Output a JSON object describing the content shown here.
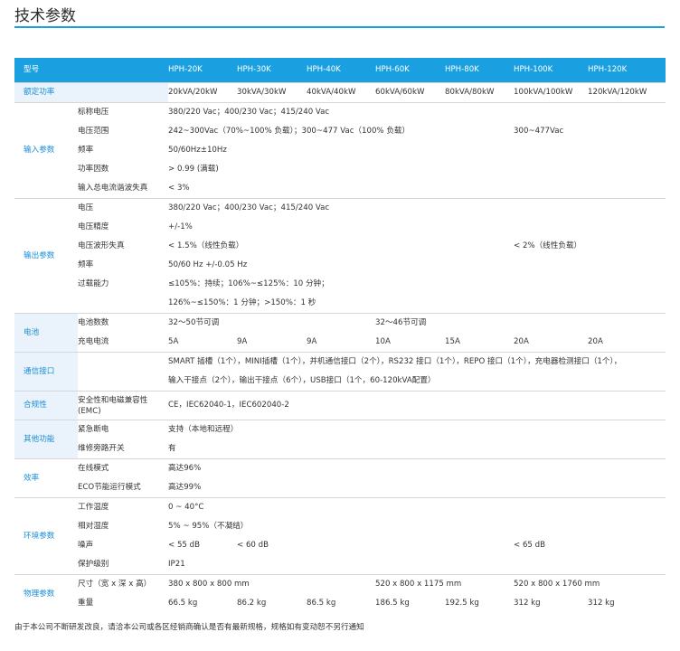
{
  "title": "技术参数",
  "models": [
    "HPH-20K",
    "HPH-30K",
    "HPH-40K",
    "HPH-60K",
    "HPH-80K",
    "HPH-100K",
    "HPH-120K"
  ],
  "model_label": "型号",
  "rated": {
    "label": "额定功率",
    "values": [
      "20kVA/20kW",
      "30kVA/30kW",
      "40kVA/40kW",
      "60kVA/60kW",
      "80kVA/80kW",
      "100kVA/100kW",
      "120kVA/120kW"
    ]
  },
  "input": {
    "group": "输入参数",
    "voltage": {
      "label": "标称电压",
      "value": "380/220 Vac；400/230 Vac；415/240 Vac"
    },
    "range": {
      "label": "电压范围",
      "value_a": "242~300Vac（70%~100% 负载）；300~477 Vac（100% 负载）",
      "value_b": "300~477Vac"
    },
    "freq": {
      "label": "频率",
      "value": "50/60Hz±10Hz"
    },
    "pf": {
      "label": "功率因数",
      "value": "> 0.99 (满载)"
    },
    "thd": {
      "label": "输入总电流谐波失真",
      "value": "< 3%"
    }
  },
  "output": {
    "group": "输出参数",
    "voltage": {
      "label": "电压",
      "value": "380/220 Vac；400/230 Vac；415/240 Vac"
    },
    "precision": {
      "label": "电压精度",
      "value": "+/-1%"
    },
    "thd": {
      "label": "电压波形失真",
      "value_a": "< 1.5%（线性负载）",
      "value_b": "< 2%（线性负载）"
    },
    "freq": {
      "label": "频率",
      "value": "50/60 Hz +/-0.05 Hz"
    },
    "overload": {
      "label": "过载能力",
      "line1": "≤105%：持续；106%~≤125%：10 分钟；",
      "line2": "126%~≤150%：1 分钟；>150%：1 秒"
    }
  },
  "battery": {
    "group": "电池",
    "count": {
      "label": "电池数数",
      "value_a": "32～50节可调",
      "value_b": "32～46节可调"
    },
    "current": {
      "label": "充电电流",
      "values": [
        "5A",
        "9A",
        "9A",
        "10A",
        "15A",
        "20A",
        "20A"
      ]
    }
  },
  "comm": {
    "group": "通信接口",
    "line1": "SMART 插槽（1个），MINI插槽（1个），并机通信接口（2个），RS232 接口（1个），REPO 接口（1个），充电器检测接口（1个），",
    "line2": "输入干接点（2个），输出干接点（6个），USB接口（1个，60-120kVA配置）"
  },
  "compliance": {
    "group": "合规性",
    "label": "安全性和电磁兼容性 (EMC)",
    "value": "CE，IEC62040-1，IEC602040-2"
  },
  "other": {
    "group": "其他功能",
    "epo": {
      "label": "紧急断电",
      "value": "支持（本地和远程）"
    },
    "bypass": {
      "label": "维修旁路开关",
      "value": "有"
    }
  },
  "efficiency": {
    "group": "效率",
    "online": {
      "label": "在线模式",
      "value": "高达96%"
    },
    "eco": {
      "label": "ECO节能运行模式",
      "value": "高达99%"
    }
  },
  "env": {
    "group": "环境参数",
    "temp": {
      "label": "工作温度",
      "value": "0 ~ 40°C"
    },
    "humidity": {
      "label": "相对湿度",
      "value": "5% ~ 95%（不凝结）"
    },
    "noise": {
      "label": "噪声",
      "value_a": "< 55 dB",
      "value_b": "< 60 dB",
      "value_c": "< 65 dB"
    },
    "protection": {
      "label": "保护级别",
      "value": "IP21"
    }
  },
  "physical": {
    "group": "物理参数",
    "size": {
      "label": "尺寸（宽 x 深 x 高）",
      "value_a": "380 x 800 x 800 mm",
      "value_b": "520 x 800 x 1175 mm",
      "value_c": "520 x 800 x 1760 mm"
    },
    "weight": {
      "label": "重量",
      "values": [
        "66.5 kg",
        "86.2 kg",
        "86.5 kg",
        "186.5 kg",
        "192.5 kg",
        "312 kg",
        "312 kg"
      ]
    }
  },
  "footnote": "由于本公司不断研发改良，请洽本公司或各区经销商确认是否有最新规格，规格如有变动恕不另行通知"
}
